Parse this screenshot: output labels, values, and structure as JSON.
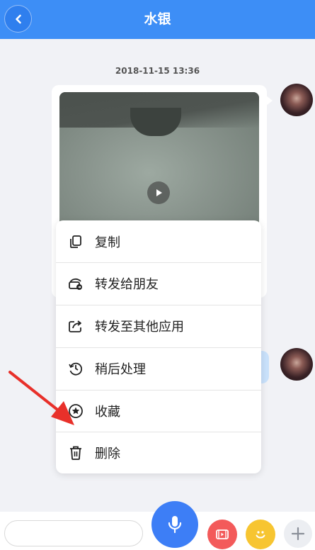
{
  "header": {
    "title": "水银",
    "background": "#3d8ef6",
    "back_icon": "chevron-left-icon"
  },
  "chat": {
    "timestamp": "2018-11-15 13:36",
    "messages": [
      {
        "type": "video",
        "sender": "self"
      },
      {
        "type": "text",
        "sender": "self"
      }
    ]
  },
  "context_menu": {
    "items": [
      {
        "label": "复制",
        "icon": "copy-icon"
      },
      {
        "label": "转发给朋友",
        "icon": "forward-friend-icon"
      },
      {
        "label": "转发至其他应用",
        "icon": "share-external-icon"
      },
      {
        "label": "稍后处理",
        "icon": "clock-later-icon"
      },
      {
        "label": "收藏",
        "icon": "star-favorite-icon"
      },
      {
        "label": "删除",
        "icon": "trash-icon"
      }
    ]
  },
  "input_bar": {
    "buttons": [
      {
        "icon": "microphone-icon",
        "color": "#3d7ef6"
      },
      {
        "icon": "video-icon",
        "color": "#f35a5a"
      },
      {
        "icon": "emoji-icon",
        "color": "#f7c531"
      },
      {
        "icon": "plus-icon",
        "color": "#eceef2"
      }
    ]
  },
  "annotation": {
    "arrow_color": "#e8302a"
  }
}
